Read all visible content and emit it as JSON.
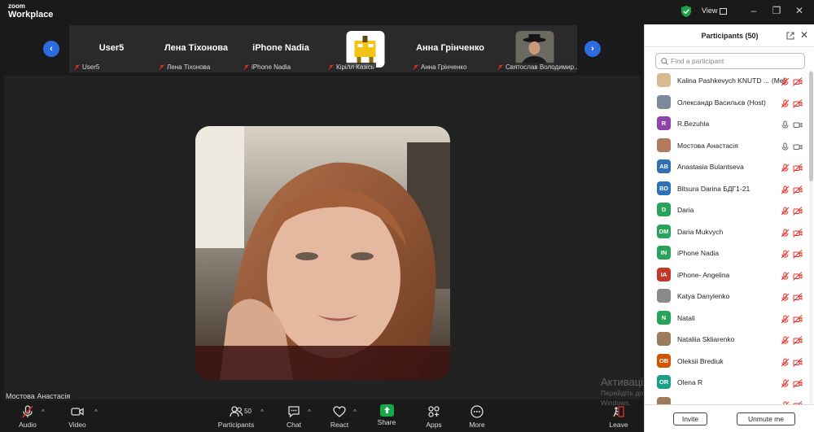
{
  "app": {
    "logo_small": "zoom",
    "logo_big": "Workplace",
    "view_label": "View",
    "colors": {
      "accent": "#2d6cdf",
      "share": "#17a84a",
      "mute": "#e0302a"
    }
  },
  "strip": {
    "tiles": [
      {
        "big_name": "User5",
        "caption": "User5"
      },
      {
        "big_name": "Лена Тіхонова",
        "caption": "Лена Тіхонова"
      },
      {
        "big_name": "iPhone  Nadia",
        "caption": "iPhone  Nadia"
      },
      {
        "big_name": "",
        "caption": "Кірілл Казісь"
      },
      {
        "big_name": "Анна Грінченко",
        "caption": "Анна Грінченко"
      },
      {
        "big_name": "",
        "caption": "Святослав Володимир..."
      }
    ]
  },
  "main": {
    "speaker_name": "Мостова Анастасія"
  },
  "toolbar": {
    "audio": "Audio",
    "video": "Video",
    "participants": "Participants",
    "participants_count": "50",
    "chat": "Chat",
    "react": "React",
    "share": "Share",
    "apps": "Apps",
    "more": "More",
    "leave": "Leave"
  },
  "panel": {
    "title": "Participants (50)",
    "search_placeholder": "Find a participant",
    "participants": [
      {
        "name": "Kalina Pashkevych KNUTD ...",
        "extra": "(Me)",
        "initials": "",
        "color": "#d9b98f",
        "mic": "muted",
        "cam": "off"
      },
      {
        "name": "Олександр Васильєв (Host)",
        "extra": "",
        "initials": "",
        "color": "#7a8a99",
        "mic": "muted",
        "cam": "off"
      },
      {
        "name": "R.Bezuhla",
        "extra": "",
        "initials": "R",
        "color": "#8e44ad",
        "mic": "on",
        "cam": "on"
      },
      {
        "name": "Мостова Анастасія",
        "extra": "",
        "initials": "",
        "color": "#b27a5c",
        "mic": "on",
        "cam": "on"
      },
      {
        "name": "Anastasia Bulantseva",
        "extra": "",
        "initials": "AB",
        "color": "#2f6fb5",
        "mic": "muted",
        "cam": "off"
      },
      {
        "name": "Bitsura Darina БДГ1-21",
        "extra": "",
        "initials": "BD",
        "color": "#2f6fb5",
        "mic": "muted",
        "cam": "off"
      },
      {
        "name": "Daria",
        "extra": "",
        "initials": "D",
        "color": "#27a35a",
        "mic": "muted",
        "cam": "off"
      },
      {
        "name": "Daria Mukvych",
        "extra": "",
        "initials": "DM",
        "color": "#27a35a",
        "mic": "muted",
        "cam": "off"
      },
      {
        "name": "iPhone  Nadia",
        "extra": "",
        "initials": "IN",
        "color": "#27a35a",
        "mic": "muted",
        "cam": "off"
      },
      {
        "name": "iPhone- Angelina",
        "extra": "",
        "initials": "IA",
        "color": "#c0392b",
        "mic": "muted",
        "cam": "off"
      },
      {
        "name": "Katya Danylenko",
        "extra": "",
        "initials": "",
        "color": "#8a8a8a",
        "mic": "muted",
        "cam": "off"
      },
      {
        "name": "Natali",
        "extra": "",
        "initials": "N",
        "color": "#27a35a",
        "mic": "muted",
        "cam": "off"
      },
      {
        "name": "Nataliia Skliarenko",
        "extra": "",
        "initials": "",
        "color": "#9a7b5c",
        "mic": "muted",
        "cam": "off"
      },
      {
        "name": "Oleksii Brediuk",
        "extra": "",
        "initials": "OB",
        "color": "#d35400",
        "mic": "muted",
        "cam": "off"
      },
      {
        "name": "Olena R",
        "extra": "",
        "initials": "OR",
        "color": "#16a085",
        "mic": "muted",
        "cam": "off"
      },
      {
        "name": "",
        "extra": "",
        "initials": "",
        "color": "#9a7b5c",
        "mic": "muted",
        "cam": "off"
      }
    ],
    "invite": "Invite",
    "unmute_me": "Unmute me"
  },
  "watermark": {
    "line1": "Активація Windows",
    "line2": "Перейдіть до розділу \"Настройки\", щоб активувати",
    "line3": "Windows."
  }
}
